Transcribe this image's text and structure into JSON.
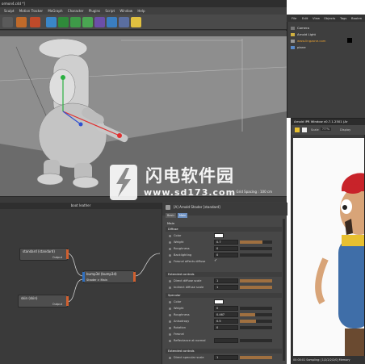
{
  "window": {
    "title": "ormon4.c4d *]"
  },
  "menu": [
    "Sculpt",
    "Motion Tracker",
    "MoGraph",
    "Character",
    "Plugins",
    "Script",
    "Window",
    "Help"
  ],
  "viewport": {
    "grid_spacing": "Grid Spacing : 100 cm"
  },
  "object_manager": {
    "tabs": [
      "File",
      "Edit",
      "View",
      "Objects",
      "Tags",
      "Bookm"
    ],
    "items": [
      "Camera",
      "Arnold Light",
      "www.lingzone.com",
      "plane"
    ]
  },
  "node_editor": {
    "title": "boot leather",
    "nodes": [
      {
        "name": "standard (standard)",
        "output": "Output"
      },
      {
        "name": "bump3d (bump3d)",
        "port": "Shader > Main"
      },
      {
        "name": "skin (skin)",
        "output": "Output"
      }
    ]
  },
  "attributes": {
    "title": "[A] Arnold Shader [standard]",
    "tabs": [
      "Basic",
      "Main"
    ],
    "section_main": "Main",
    "diffuse_header": "Diffuse",
    "diffuse_rows": [
      {
        "label": "Color",
        "kind": "swatch"
      },
      {
        "label": "Weight",
        "value": "0.7",
        "level": 0.7
      },
      {
        "label": "Roughness",
        "value": "0",
        "level": 0
      },
      {
        "label": "Backlighting",
        "value": "0",
        "level": 0
      },
      {
        "label": "Fresnel affects diffuse",
        "kind": "check",
        "mark": "✓"
      }
    ],
    "extended_header": "Extended controls",
    "extended_rows": [
      {
        "label": "Direct diffuse scale",
        "value": "1",
        "level": 1
      },
      {
        "label": "Indirect diffuse scale",
        "value": "1",
        "level": 1
      }
    ],
    "specular_header": "Specular",
    "specular_rows": [
      {
        "label": "Color",
        "kind": "swatch"
      },
      {
        "label": "Weight",
        "value": "0",
        "level": 0
      },
      {
        "label": "Roughness",
        "value": "0.467",
        "level": 0.467
      },
      {
        "label": "Anisotropy",
        "value": "0.5",
        "level": 0.5
      },
      {
        "label": "Rotation",
        "value": "0",
        "level": 0
      },
      {
        "label": "Fresnel",
        "kind": "check",
        "mark": ""
      },
      {
        "label": "Reflectance at normal",
        "value": "",
        "level": 0
      }
    ],
    "extended_header_2": "Extended controls",
    "extended_rows_2": [
      {
        "label": "Direct specular scale",
        "value": "1",
        "level": 1
      }
    ]
  },
  "render_window": {
    "title": "Arnold IPR Window v0.7.1.2501 (Ar",
    "scale_label": "Scale",
    "scale_value": "???%",
    "display_label": "Display",
    "status": "00:00:01 Sampling: [1/2/2/2/2/0] Memory"
  },
  "watermark": {
    "text": "闪电软件园",
    "url": "www.sd173.com"
  },
  "colors": {
    "accent_active_tab": "#6c8fbf",
    "slider_fill": "#a07040",
    "cap_red": "#c8232a",
    "overalls_blue": "#3f6ea8",
    "skin": "#d8a478"
  }
}
